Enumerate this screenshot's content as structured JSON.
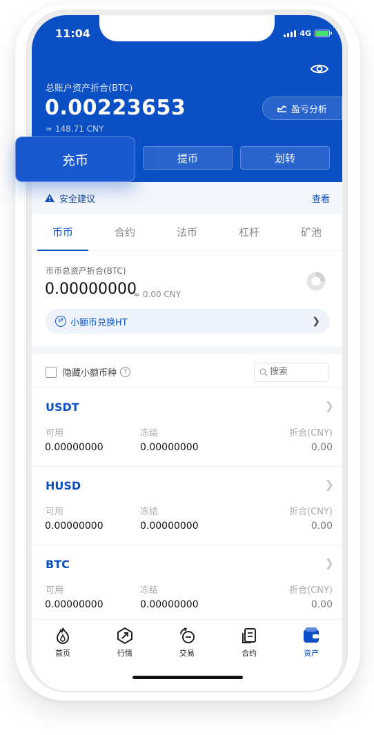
{
  "status_bar": {
    "time": "11:04",
    "network": "4G"
  },
  "header": {
    "total_label": "总账户资产折合(BTC)",
    "total_value": "0.00223653",
    "total_cny": "≈ 148.71 CNY",
    "pnl_label": "盈亏分析",
    "actions": {
      "deposit": "充币",
      "withdraw": "提币",
      "transfer": "划转"
    }
  },
  "security": {
    "label": "安全建议",
    "view": "查看"
  },
  "tabs": [
    "币币",
    "合约",
    "法币",
    "杠杆",
    "矿池"
  ],
  "summary": {
    "label": "币币总资产折合(BTC)",
    "value": "0.00000000",
    "cny": "≈ 0.00 CNY"
  },
  "convert": {
    "label": "小额币兑换HT",
    "icon": "swap-icon"
  },
  "filter": {
    "hide_small": "隐藏小额币种",
    "search_placeholder": "搜索"
  },
  "columns": {
    "available": "可用",
    "frozen": "冻结",
    "value_cny": "折合(CNY)"
  },
  "coins": [
    {
      "name": "USDT",
      "available": "0.00000000",
      "frozen": "0.00000000",
      "value": "0.00"
    },
    {
      "name": "HUSD",
      "available": "0.00000000",
      "frozen": "0.00000000",
      "value": "0.00"
    },
    {
      "name": "BTC",
      "available": "0.00000000",
      "frozen": "0.00000000",
      "value": "0.00"
    }
  ],
  "nav": [
    {
      "label": "首页",
      "icon": "flame-icon"
    },
    {
      "label": "行情",
      "icon": "compass-icon"
    },
    {
      "label": "交易",
      "icon": "exchange-icon"
    },
    {
      "label": "合约",
      "icon": "contract-icon"
    },
    {
      "label": "资产",
      "icon": "wallet-icon"
    }
  ],
  "colors": {
    "brand": "#0b4fc4",
    "battery": "#47e36b"
  }
}
